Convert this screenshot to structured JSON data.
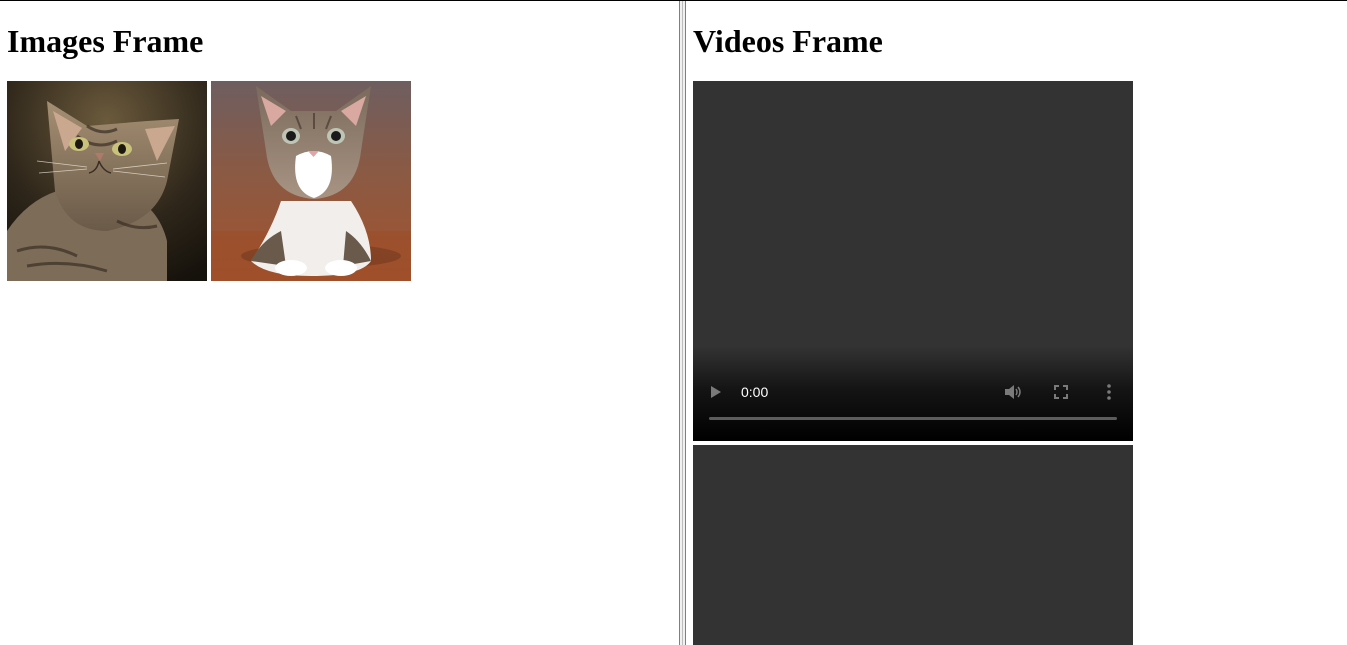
{
  "images_frame": {
    "heading": "Images Frame",
    "images": [
      {
        "alt": "Tabby cat looking up"
      },
      {
        "alt": "Kitten sitting"
      }
    ]
  },
  "videos_frame": {
    "heading": "Videos Frame",
    "videos": [
      {
        "time": "0:00",
        "progress": 0
      },
      {}
    ]
  },
  "colors": {
    "video_background": "#333333",
    "control_icon": "#7a7a7a"
  },
  "icons": [
    "play-icon",
    "volume-icon",
    "fullscreen-icon",
    "more-options-icon"
  ]
}
